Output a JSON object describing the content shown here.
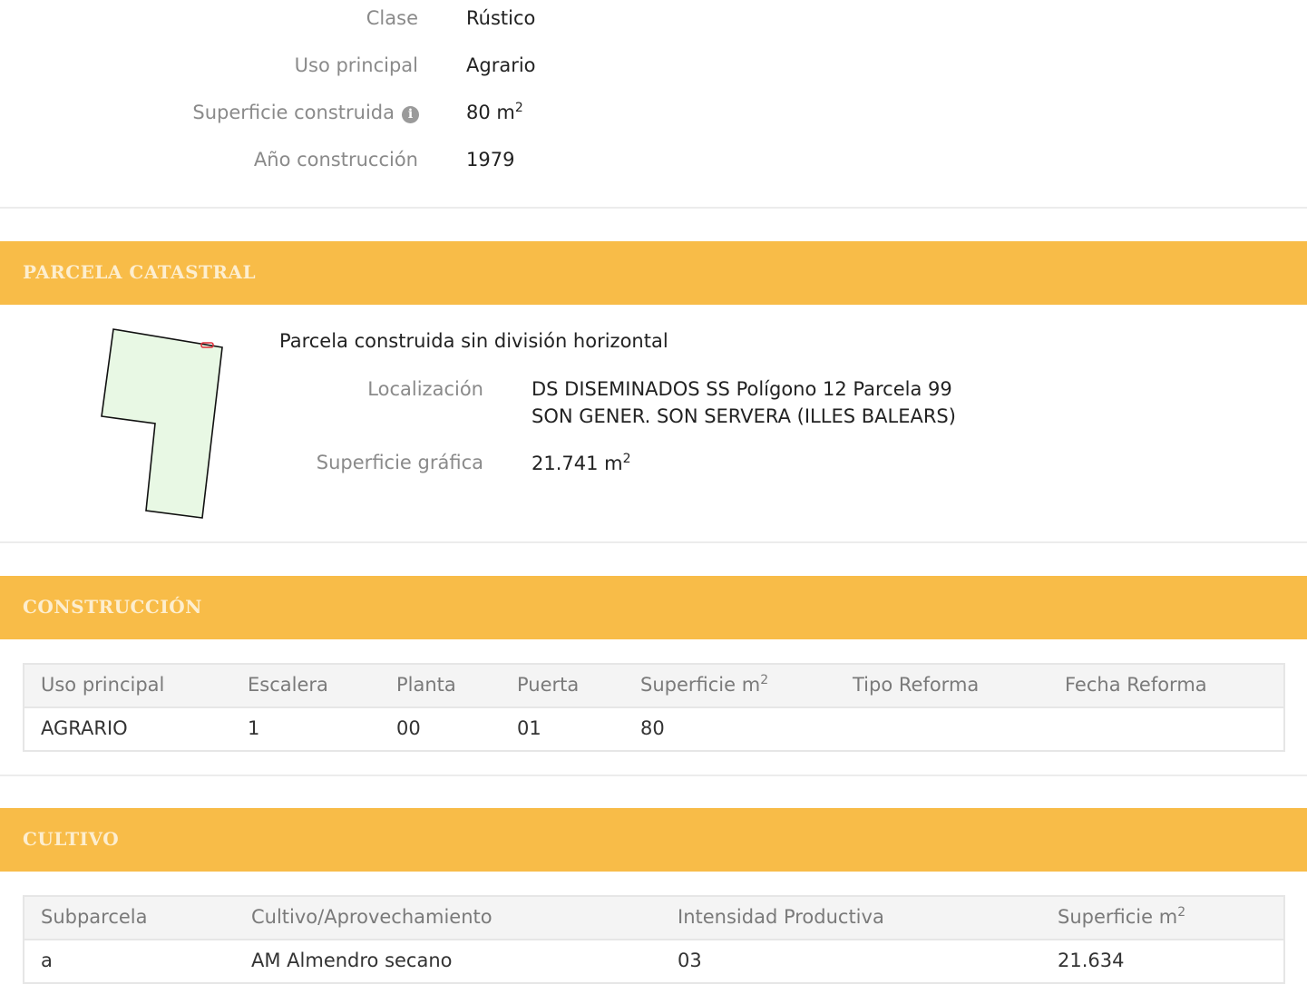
{
  "inmueble": {
    "rows": [
      {
        "label": "Clase",
        "value": "Rústico"
      },
      {
        "label": "Uso principal",
        "value": "Agrario"
      },
      {
        "label": "Superficie construida",
        "value": "80 m",
        "unit_sup": "2",
        "info_icon": "info-icon"
      },
      {
        "label": "Año construcción",
        "value": "1979"
      }
    ]
  },
  "parcela": {
    "section_title": "PARCELA CATASTRAL",
    "description": "Parcela construida sin división horizontal",
    "localizacion_label": "Localización",
    "localizacion_line1": "DS DISEMINADOS SS Polígono 12 Parcela 99",
    "localizacion_line2": "SON GENER. SON SERVERA (ILLES BALEARS)",
    "superficie_label": "Superficie gráfica",
    "superficie_value": "21.741 m",
    "superficie_sup": "2",
    "shape_fill": "#e8f8e4",
    "marker_color": "#e0303a"
  },
  "construccion": {
    "section_title": "CONSTRUCCIÓN",
    "headers": [
      "Uso principal",
      "Escalera",
      "Planta",
      "Puerta",
      "Superficie m",
      "Tipo Reforma",
      "Fecha Reforma"
    ],
    "header_sup": "2",
    "rows": [
      [
        "AGRARIO",
        "1",
        "00",
        "01",
        "80",
        "",
        ""
      ]
    ]
  },
  "cultivo": {
    "section_title": "CULTIVO",
    "headers": [
      "Subparcela",
      "Cultivo/Aprovechamiento",
      "Intensidad Productiva",
      "Superficie m"
    ],
    "header_sup": "2",
    "rows": [
      [
        "a",
        "AM Almendro secano",
        "03",
        "21.634"
      ]
    ]
  },
  "colors": {
    "section_bar": "#f8bc48",
    "section_title_text": "#fdeecf",
    "label_text": "#8a8a8a"
  }
}
